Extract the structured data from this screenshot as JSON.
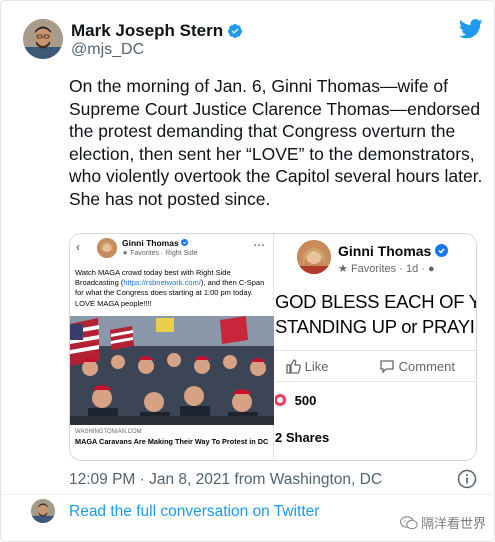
{
  "author": {
    "name": "Mark Joseph Stern",
    "handle": "@mjs_DC"
  },
  "tweet": {
    "text": "On the morning of Jan. 6, Ginni Thomas—wife of Supreme Court Justice Clarence Thomas—endorsed the protest demanding that Congress overturn the election, then sent her “LOVE” to the demonstrators, who violently overtook the Capitol several hours later. She has not posted since."
  },
  "media": {
    "left": {
      "name": "Ginni Thomas",
      "favorites": "★ Favorites · Right Side",
      "text_a": "Watch MAGA crowd today best with Right Side Broadcasting (",
      "text_link": "https://rsbnetwork.com/",
      "text_b": "), and then C-Span for what the Congress does starting at 1:00 pm today. LOVE MAGA people!!!!",
      "link_domain": "WASHINGTONIAN.COM",
      "link_title": "MAGA Caravans Are Making Their Way To Protest in DC"
    },
    "right": {
      "name": "Ginni Thomas",
      "favorites": "Favorites · 1d ·",
      "line1": "GOD BLESS EACH OF Y",
      "line2": "STANDING UP or PRAYIN",
      "like": "Like",
      "comment": "Comment",
      "reactions": "500",
      "shares": "2 Shares"
    }
  },
  "meta": {
    "timestamp": "12:09 PM · Jan 8, 2021 from Washington, DC"
  },
  "footer": {
    "read_more": "Read the full conversation on Twitter",
    "watermark": "隔洋看世界"
  },
  "colors": {
    "twitter_blue": "#1d9bf0",
    "text": "#0f1419",
    "muted": "#536471"
  },
  "icons": [
    "twitter-bird-icon",
    "verified-badge-icon",
    "info-icon",
    "like-icon",
    "comment-icon",
    "wechat-icon"
  ]
}
